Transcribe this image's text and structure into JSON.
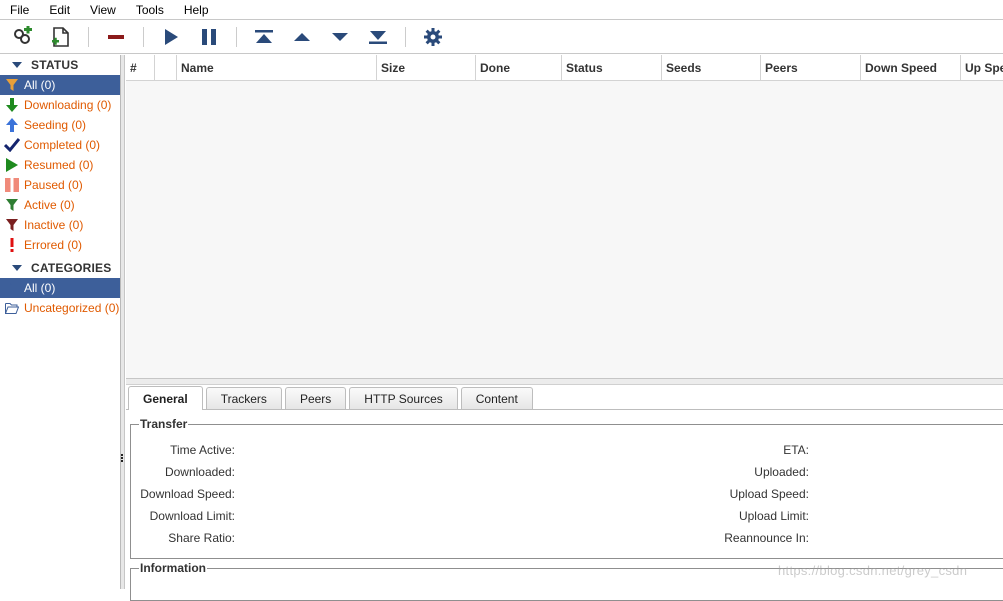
{
  "menu": [
    "File",
    "Edit",
    "View",
    "Tools",
    "Help"
  ],
  "toolbar": {
    "icons": [
      "add-torrent-link-icon",
      "add-torrent-file-icon",
      "delete-icon",
      "resume-icon",
      "pause-icon",
      "move-top-icon",
      "move-up-icon",
      "move-down-icon",
      "move-bottom-icon",
      "options-gear-icon"
    ]
  },
  "sidebar": {
    "status_header": "STATUS",
    "status_items": [
      {
        "label": "All (0)",
        "icon": "filter-icon"
      },
      {
        "label": "Downloading (0)",
        "icon": "down-arrow-icon"
      },
      {
        "label": "Seeding (0)",
        "icon": "up-arrow-icon"
      },
      {
        "label": "Completed (0)",
        "icon": "checkmark-icon"
      },
      {
        "label": "Resumed (0)",
        "icon": "play-icon"
      },
      {
        "label": "Paused (0)",
        "icon": "pause-icon"
      },
      {
        "label": "Active (0)",
        "icon": "filter-green-icon"
      },
      {
        "label": "Inactive (0)",
        "icon": "filter-red-icon"
      },
      {
        "label": "Errored (0)",
        "icon": "exclamation-icon"
      }
    ],
    "categories_header": "CATEGORIES",
    "category_items": [
      {
        "label": "All (0)",
        "icon": "folder-icon"
      },
      {
        "label": "Uncategorized (0)",
        "icon": "folder-open-icon"
      }
    ]
  },
  "table": {
    "columns": [
      "#",
      "",
      "Name",
      "Size",
      "Done",
      "Status",
      "Seeds",
      "Peers",
      "Down Speed",
      "Up Spe"
    ]
  },
  "tabs": [
    "General",
    "Trackers",
    "Peers",
    "HTTP Sources",
    "Content"
  ],
  "transfer": {
    "legend": "Transfer",
    "left": [
      "Time Active:",
      "Downloaded:",
      "Download Speed:",
      "Download Limit:",
      "Share Ratio:"
    ],
    "right": [
      "ETA:",
      "Uploaded:",
      "Upload Speed:",
      "Upload Limit:",
      "Reannounce In:"
    ]
  },
  "information": {
    "legend": "Information"
  },
  "watermark": "https://blog.csdn.net/grey_csdn",
  "colors": {
    "accent": "#3d5f9a",
    "link": "#e05a00",
    "icon_blue": "#2a4a7a"
  }
}
